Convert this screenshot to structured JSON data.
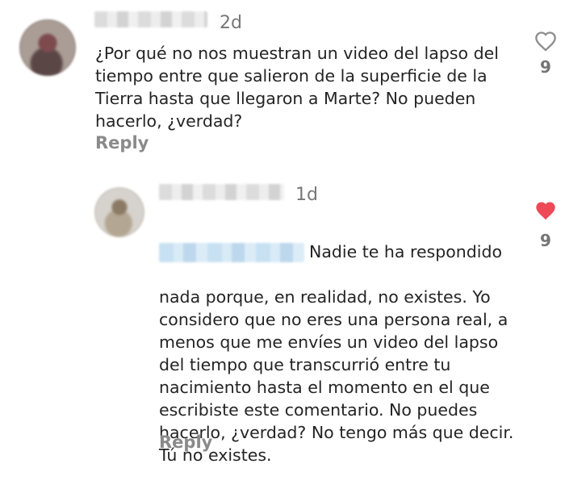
{
  "comments": [
    {
      "time": "2d",
      "text": "¿Por qué no nos muestran un video del lapso del\ntiempo entre que salieron de la superficie de la\nTierra hasta que llegaron a Marte? No pueden\nhacerlo, ¿verdad?",
      "reply_label": "Reply",
      "likes": "9",
      "liked": false
    },
    {
      "time": "1d",
      "text_first_line": "Nadie te ha respondido",
      "text_rest": "nada porque, en realidad, no existes. Yo\nconsidero que no eres una persona real, a\nmenos que me envíes un video del lapso\ndel tiempo que transcurrió entre tu\nnacimiento hasta el momento en el que\nescribiste este comentario. No puedes\nhacerlo, ¿verdad? No tengo más que decir.\nTú no existes.",
      "reply_label": "Reply",
      "likes": "9",
      "liked": true
    }
  ],
  "colors": {
    "heart_outline": "#8e8e8e",
    "heart_filled": "#ed4956",
    "reply": "#8a8a8a",
    "text": "#242424",
    "meta": "#777777"
  },
  "icons": {
    "like_empty": "heart-outline-icon",
    "like_filled": "heart-filled-icon"
  }
}
